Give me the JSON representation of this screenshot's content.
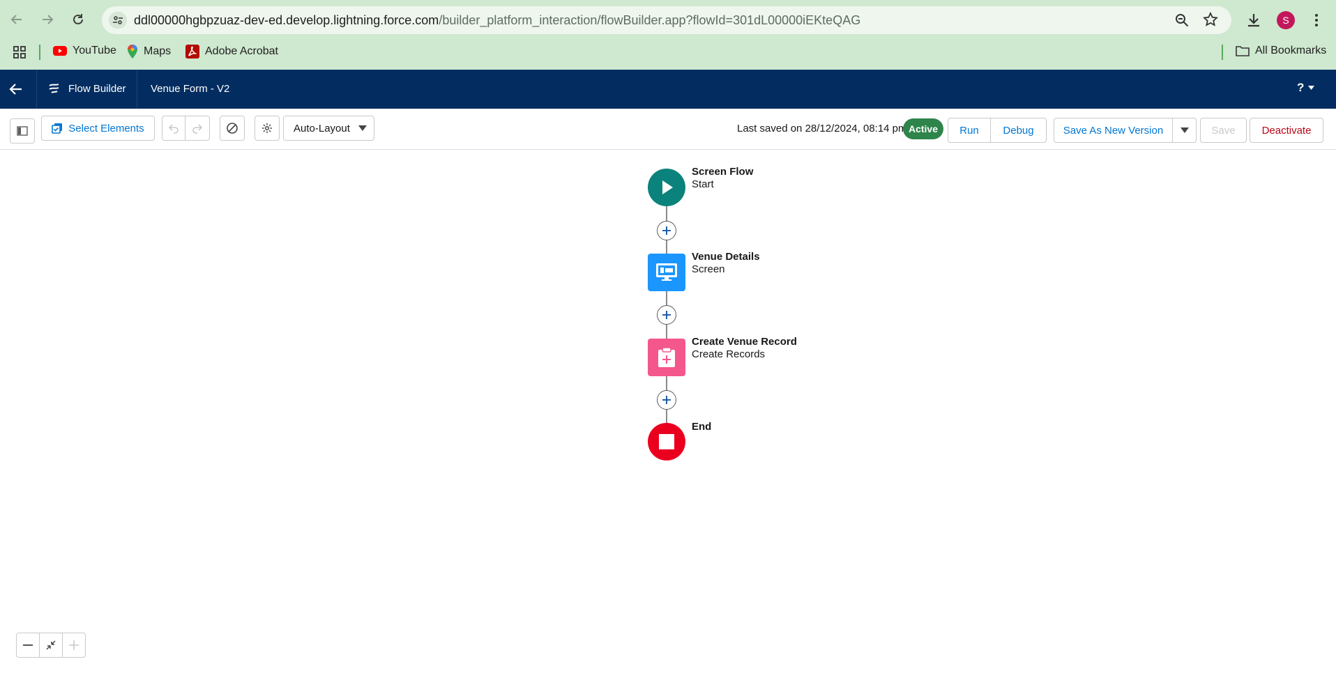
{
  "browser": {
    "url_host": "ddl00000hgbpzuaz-dev-ed.develop.lightning.force.com",
    "url_path": "/builder_platform_interaction/flowBuilder.app?flowId=301dL00000iEKteQAG",
    "profile_initial": "S",
    "bookmarks": [
      {
        "label": "YouTube"
      },
      {
        "label": "Maps"
      },
      {
        "label": "Adobe Acrobat"
      }
    ],
    "all_bookmarks_label": "All Bookmarks"
  },
  "header": {
    "app_name": "Flow Builder",
    "flow_title": "Venue Form - V2",
    "help_label": "?"
  },
  "toolbar": {
    "select_elements_label": "Select Elements",
    "layout_mode": "Auto-Layout",
    "last_saved": "Last saved on 28/12/2024, 08:14 pm",
    "status_badge": "Active",
    "run_label": "Run",
    "debug_label": "Debug",
    "save_as_new_version_label": "Save As New Version",
    "save_label": "Save",
    "deactivate_label": "Deactivate"
  },
  "canvas": {
    "nodes": [
      {
        "title": "Screen Flow",
        "subtitle": "Start",
        "color": "#0b827c",
        "icon": "play-icon"
      },
      {
        "title": "Venue Details",
        "subtitle": "Screen",
        "color": "#1b96ff",
        "icon": "screen-icon"
      },
      {
        "title": "Create Venue Record",
        "subtitle": "Create Records",
        "color": "#f4578c",
        "icon": "create-record-icon"
      },
      {
        "title": "End",
        "subtitle": "",
        "color": "#ea001e",
        "icon": "stop-icon"
      }
    ]
  },
  "colors": {
    "chrome": "#cfe8d0",
    "header": "#032d60",
    "brand_blue": "#0176d3",
    "active_green": "#2e844a",
    "deactivate_red": "#ba0517"
  }
}
